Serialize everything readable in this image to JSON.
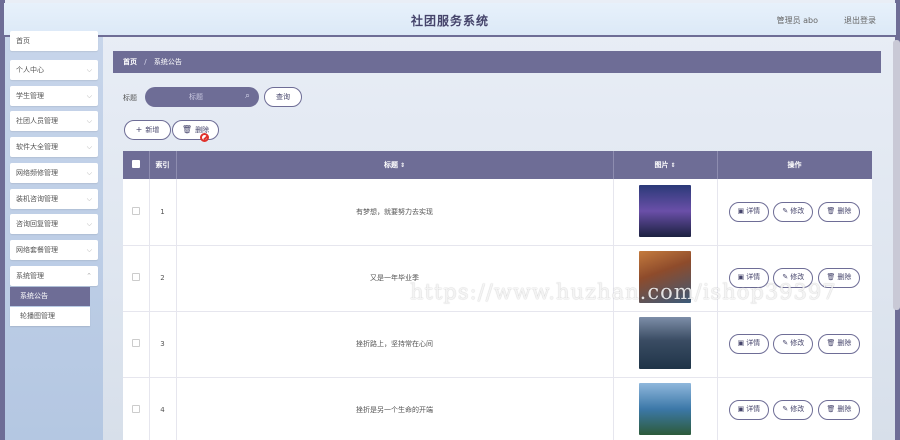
{
  "header": {
    "title": "社团服务系统",
    "user_label": "管理员 abo",
    "logout_label": "退出登录"
  },
  "sidebar": {
    "items": [
      {
        "label": "首页"
      },
      {
        "label": "个人中心"
      },
      {
        "label": "学生管理"
      },
      {
        "label": "社团人员管理"
      },
      {
        "label": "软件大全管理"
      },
      {
        "label": "网络频修管理"
      },
      {
        "label": "装机咨询管理"
      },
      {
        "label": "咨询回复管理"
      },
      {
        "label": "网络套餐管理"
      },
      {
        "label": "系统管理"
      }
    ],
    "submenu": [
      {
        "label": "系统公告"
      },
      {
        "label": "轮播图管理"
      }
    ]
  },
  "breadcrumb": {
    "home": "首页",
    "separator": "/",
    "current": "系统公告"
  },
  "search": {
    "label": "标题",
    "placeholder": "标题",
    "button": "查询"
  },
  "actions": {
    "add": "新增",
    "delete": "删除"
  },
  "table": {
    "headers": {
      "index": "索引",
      "title": "标题",
      "image": "图片",
      "ops": "操作"
    },
    "rows": [
      {
        "index": "1",
        "title": "有梦想，就要努力去实现"
      },
      {
        "index": "2",
        "title": "又是一年毕业季"
      },
      {
        "index": "3",
        "title": "挫折路上，坚持常在心间"
      },
      {
        "index": "4",
        "title": "挫折是另一个生命的开端"
      }
    ],
    "ops": {
      "detail": "详情",
      "edit": "修改",
      "delete": "删除"
    }
  },
  "watermark": "https://www.huzhan.com/ishop39397",
  "colors": {
    "accent": "#6e6d96",
    "header_bg": "#e2eefa",
    "sidebar_bg": "#bccce6"
  }
}
